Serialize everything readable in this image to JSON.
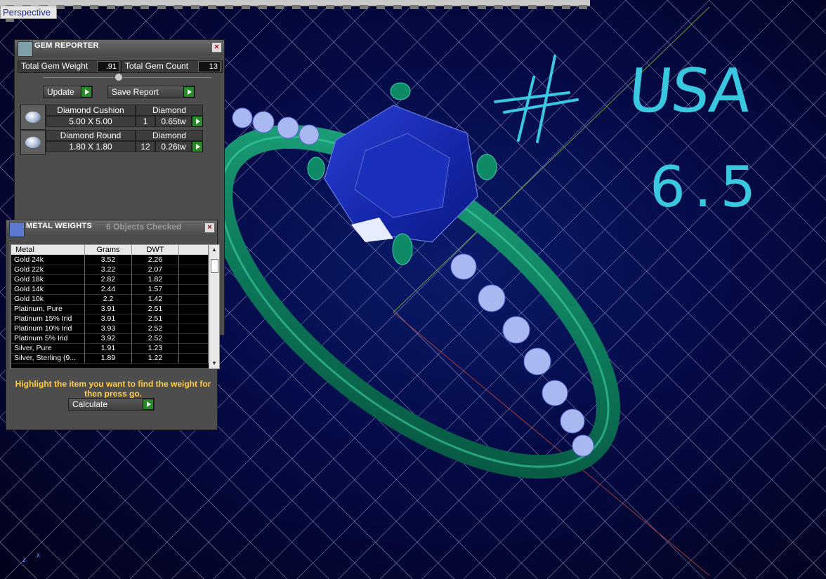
{
  "viewport": {
    "tab_label": "Perspective",
    "axis_z": "z",
    "axis_x": "x",
    "annotation_hash": "#",
    "annotation_country": "USA",
    "annotation_size": "6.5"
  },
  "gem_reporter": {
    "title": "GEM REPORTER",
    "total_weight_label": "Total Gem Weight",
    "total_weight_value": ".91",
    "total_count_label": "Total Gem Count",
    "total_count_value": "13",
    "update_label": "Update",
    "save_report_label": "Save Report",
    "gems": [
      {
        "name": "Diamond Cushion",
        "material": "Diamond",
        "size": "5.00 X 5.00",
        "qty": "1",
        "weight": "0.65tw"
      },
      {
        "name": "Diamond Round",
        "material": "Diamond",
        "size": "1.80 X 1.80",
        "qty": "12",
        "weight": "0.26tw"
      }
    ]
  },
  "metal_weights": {
    "title": "METAL WEIGHTS",
    "objects_checked": "6 Objects Checked",
    "columns": [
      "Metal",
      "Grams",
      "DWT",
      ""
    ],
    "rows": [
      {
        "metal": "Gold 24k",
        "grams": "3.52",
        "dwt": "2.26"
      },
      {
        "metal": "Gold 22k",
        "grams": "3.22",
        "dwt": "2.07"
      },
      {
        "metal": "Gold 18k",
        "grams": "2.82",
        "dwt": "1.82"
      },
      {
        "metal": "Gold 14k",
        "grams": "2.44",
        "dwt": "1.57"
      },
      {
        "metal": "Gold 10k",
        "grams": "2.2",
        "dwt": "1.42"
      },
      {
        "metal": "Platinum, Pure",
        "grams": "3.91",
        "dwt": "2.51"
      },
      {
        "metal": "Platinum 15% Irid",
        "grams": "3.91",
        "dwt": "2.51"
      },
      {
        "metal": "Platinum 10% Irid",
        "grams": "3.93",
        "dwt": "2.52"
      },
      {
        "metal": "Platinum 5% Irid",
        "grams": "3.92",
        "dwt": "2.52"
      },
      {
        "metal": "Silver, Pure",
        "grams": "1.91",
        "dwt": "1.23"
      },
      {
        "metal": "Silver, Sterling (9...",
        "grams": "1.89",
        "dwt": "1.22"
      }
    ],
    "hint": "Highlight the item you want to find the weight for then press go.",
    "calculate_label": "Calculate"
  }
}
